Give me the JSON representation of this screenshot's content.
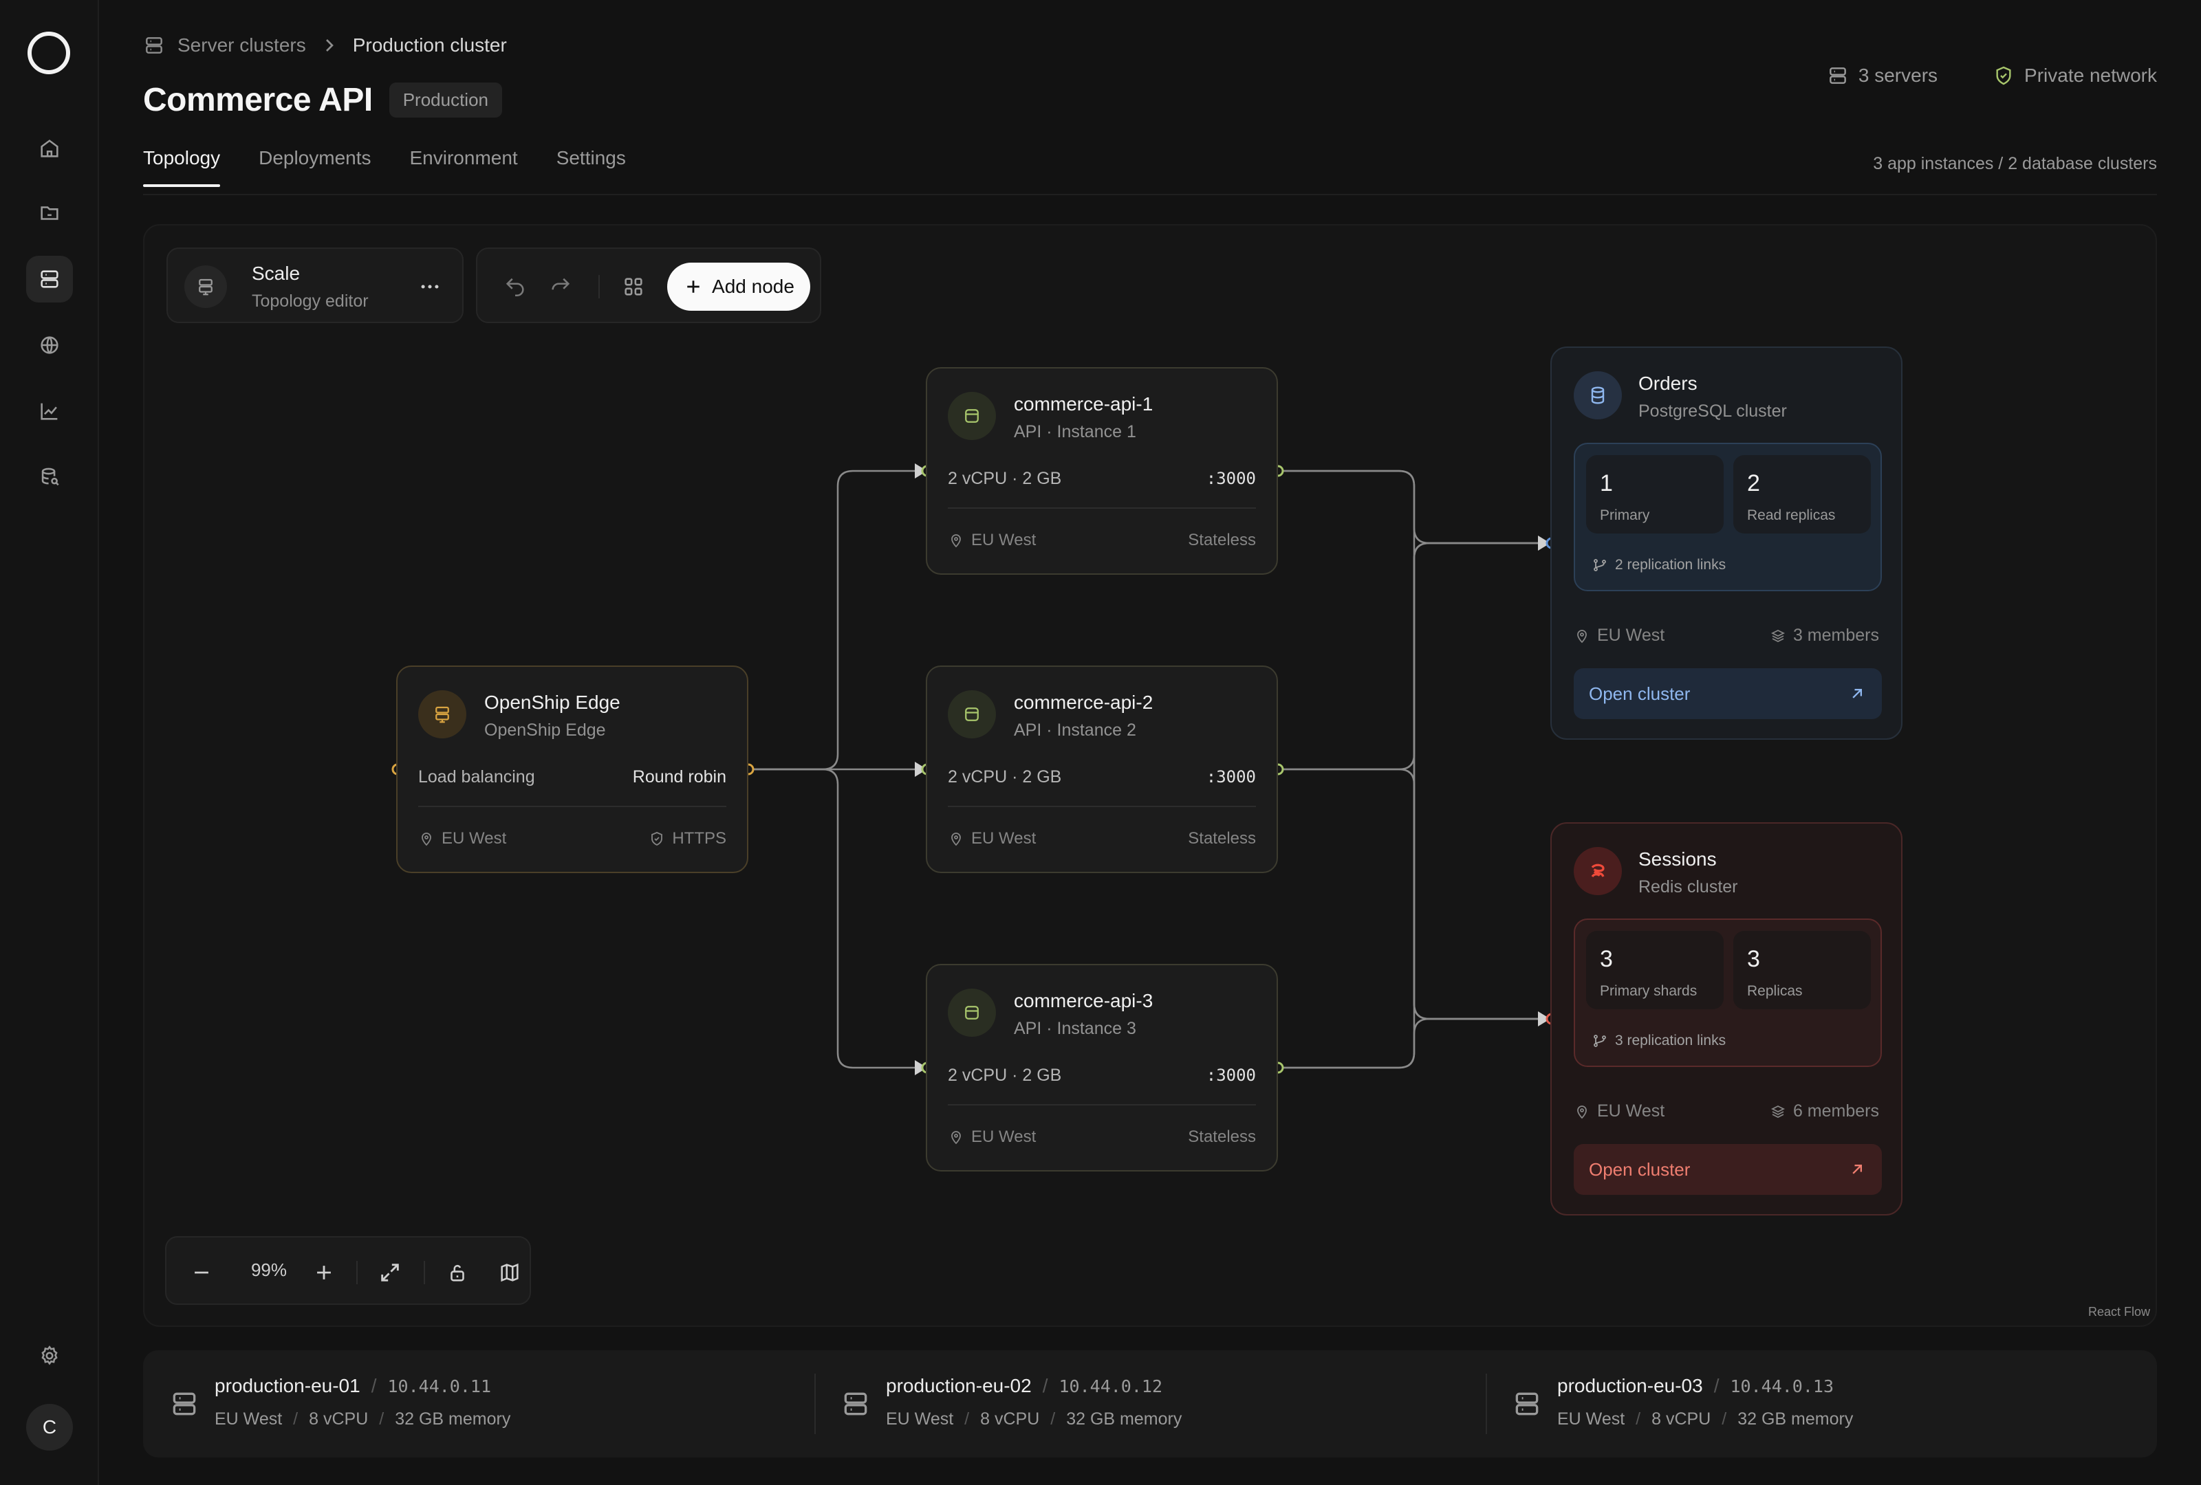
{
  "breadcrumb": {
    "parent": "Server clusters",
    "current": "Production cluster"
  },
  "page": {
    "title": "Commerce API",
    "env_badge": "Production"
  },
  "header_meta": {
    "servers": "3 servers",
    "network": "Private network"
  },
  "tabs": [
    {
      "label": "Topology",
      "active": true
    },
    {
      "label": "Deployments",
      "active": false
    },
    {
      "label": "Environment",
      "active": false
    },
    {
      "label": "Settings",
      "active": false
    }
  ],
  "instance_summary": "3 app instances / 2 database clusters",
  "scale_panel": {
    "title": "Scale",
    "subtitle": "Topology editor"
  },
  "toolbar": {
    "add_node_label": "Add node"
  },
  "zoom": {
    "level": "99%"
  },
  "attribution": "React Flow",
  "load_balancer": {
    "title": "OpenShip Edge",
    "subtitle": "OpenShip Edge",
    "row_label": "Load balancing",
    "row_value": "Round robin",
    "region": "EU West",
    "protocol": "HTTPS"
  },
  "api_nodes": [
    {
      "title": "commerce-api-1",
      "subtitle": "API · Instance 1",
      "spec": "2 vCPU · 2 GB",
      "port": ":3000",
      "region": "EU West",
      "state": "Stateless"
    },
    {
      "title": "commerce-api-2",
      "subtitle": "API · Instance 2",
      "spec": "2 vCPU · 2 GB",
      "port": ":3000",
      "region": "EU West",
      "state": "Stateless"
    },
    {
      "title": "commerce-api-3",
      "subtitle": "API · Instance 3",
      "spec": "2 vCPU · 2 GB",
      "port": ":3000",
      "region": "EU West",
      "state": "Stateless"
    }
  ],
  "databases": [
    {
      "title": "Orders",
      "subtitle": "PostgreSQL cluster",
      "stat1_value": "1",
      "stat1_label": "Primary",
      "stat2_value": "2",
      "stat2_label": "Read replicas",
      "replication": "2 replication links",
      "region": "EU West",
      "members": "3 members",
      "open_label": "Open cluster",
      "accent": "#8fb7ef"
    },
    {
      "title": "Sessions",
      "subtitle": "Redis cluster",
      "stat1_value": "3",
      "stat1_label": "Primary shards",
      "stat2_value": "3",
      "stat2_label": "Replicas",
      "replication": "3 replication links",
      "region": "EU West",
      "members": "6 members",
      "open_label": "Open cluster",
      "accent": "#ef7e70"
    }
  ],
  "servers": [
    {
      "name": "production-eu-01",
      "ip": "10.44.0.11",
      "region": "EU West",
      "cpu": "8 vCPU",
      "memory": "32 GB memory"
    },
    {
      "name": "production-eu-02",
      "ip": "10.44.0.12",
      "region": "EU West",
      "cpu": "8 vCPU",
      "memory": "32 GB memory"
    },
    {
      "name": "production-eu-03",
      "ip": "10.44.0.13",
      "region": "EU West",
      "cpu": "8 vCPU",
      "memory": "32 GB memory"
    }
  ],
  "user": {
    "initial": "C"
  },
  "colors": {
    "edge": "#8a8a8a",
    "handle_api": "#a8c66c",
    "handle_lb": "#d9a441",
    "handle_pg": "#5b8fd6",
    "handle_redis": "#e05a4a"
  }
}
